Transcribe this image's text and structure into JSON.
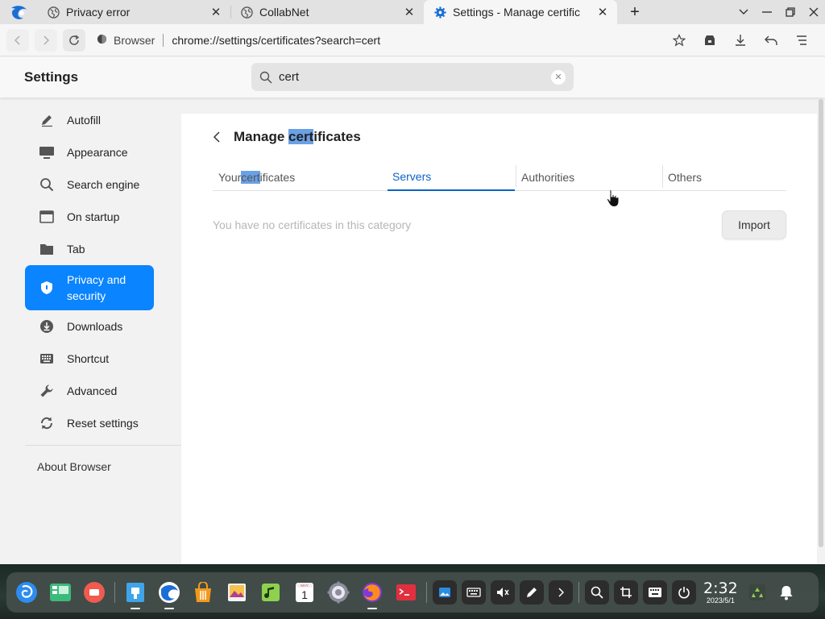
{
  "tabs": [
    {
      "title": "Privacy error",
      "favicon": "globe-icon",
      "active": false
    },
    {
      "title": "CollabNet",
      "favicon": "globe-icon",
      "active": false
    },
    {
      "title": "Settings - Manage certific",
      "favicon": "gear-icon",
      "active": true
    }
  ],
  "toolbar": {
    "site_label": "Browser",
    "url": "chrome://settings/certificates?search=cert"
  },
  "settings": {
    "title": "Settings",
    "search_value": "cert",
    "sidebar": [
      {
        "label": "Autofill",
        "icon": "pencil-icon"
      },
      {
        "label": "Appearance",
        "icon": "monitor-icon"
      },
      {
        "label": "Search engine",
        "icon": "search-icon"
      },
      {
        "label": "On startup",
        "icon": "window-icon"
      },
      {
        "label": "Tab",
        "icon": "folder-icon"
      },
      {
        "label": "Privacy and security",
        "icon": "shield-icon",
        "active": true
      },
      {
        "label": "Downloads",
        "icon": "download-icon"
      },
      {
        "label": "Shortcut",
        "icon": "keyboard-icon"
      },
      {
        "label": "Advanced",
        "icon": "wrench-icon"
      },
      {
        "label": "Reset settings",
        "icon": "reset-icon"
      }
    ],
    "about_label": "About Browser"
  },
  "page": {
    "title_pre": "Manage ",
    "title_hl": "cert",
    "title_post": "ificates",
    "tabs": [
      {
        "pre": "Your ",
        "hl": "cert",
        "post": "ificates",
        "selected": false
      },
      {
        "label": "Servers",
        "selected": true
      },
      {
        "label": "Authorities",
        "selected": false
      },
      {
        "label": "Others",
        "selected": false
      }
    ],
    "empty_message": "You have no certificates in this category",
    "import_label": "Import"
  },
  "dock": {
    "time": "2:32",
    "date": "2023/5/1",
    "calendar_month": "MAY",
    "calendar_day": "1"
  },
  "colors": {
    "accent": "#0a84ff",
    "selected_tab": "#0b63c6",
    "highlight": "#6aa0e6"
  }
}
